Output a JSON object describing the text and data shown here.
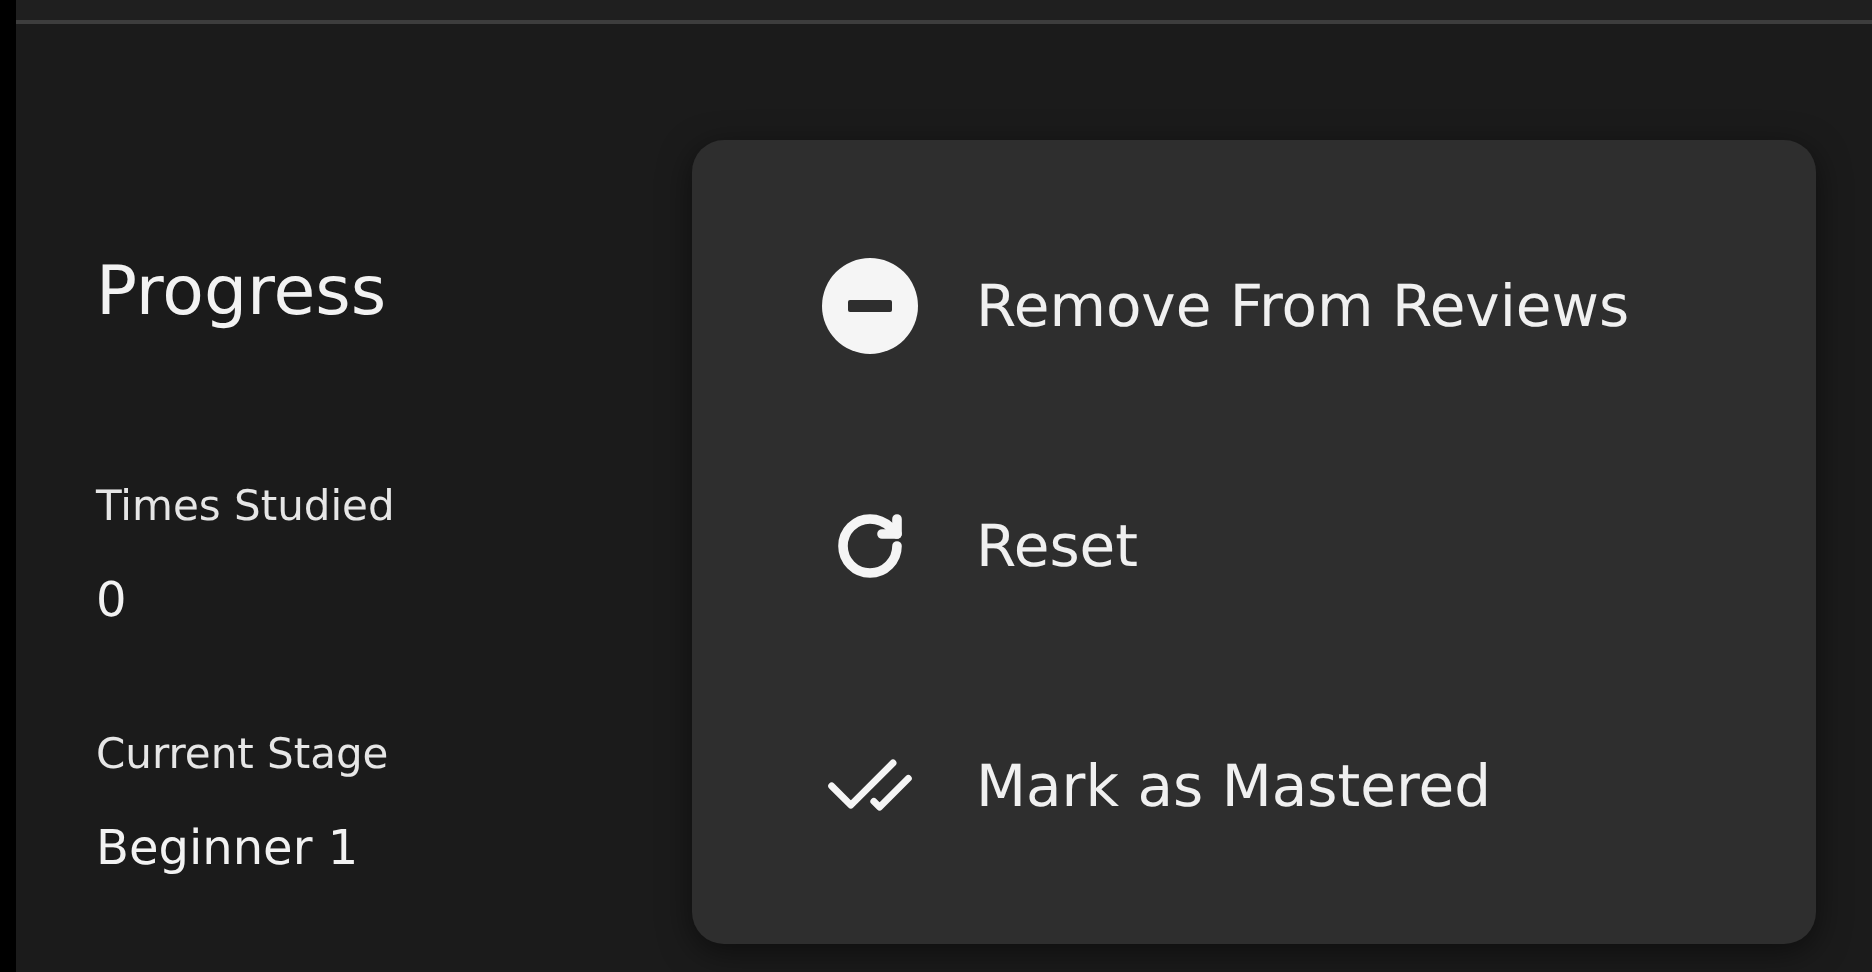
{
  "section": {
    "title": "Progress"
  },
  "stats": [
    {
      "label": "Times Studied",
      "value": "0"
    },
    {
      "label": "Current Stage",
      "value": "Beginner 1"
    }
  ],
  "menu": {
    "items": [
      {
        "kind": "remove",
        "label": "Remove From Reviews"
      },
      {
        "kind": "reset",
        "label": "Reset"
      },
      {
        "kind": "mastered",
        "label": "Mark as Mastered"
      }
    ]
  }
}
